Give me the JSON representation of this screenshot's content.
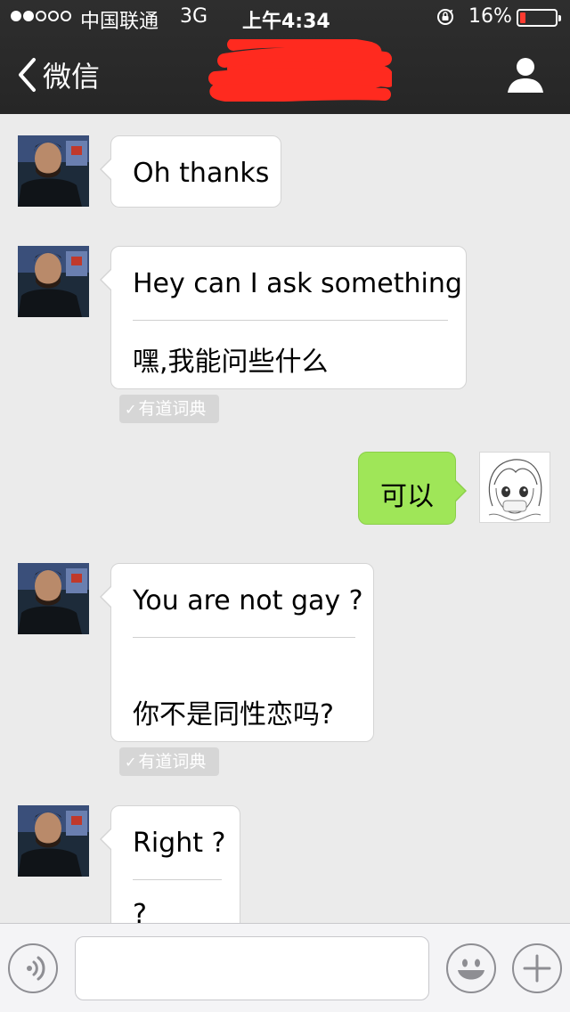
{
  "status_bar": {
    "signal_filled": 2,
    "signal_total": 5,
    "carrier": "中国联通",
    "network": "3G",
    "time": "上午4:34",
    "battery_percent_label": "16%",
    "battery_level": 0.16,
    "battery_color": "#ff3b30"
  },
  "nav": {
    "back_label": "微信",
    "back_icon": "chevron-left-icon",
    "title_redacted": true,
    "profile_icon": "person-icon"
  },
  "messages": [
    {
      "direction": "incoming",
      "sender": "contact",
      "text": "Oh thanks"
    },
    {
      "direction": "incoming",
      "sender": "contact",
      "text": "Hey can I ask something",
      "translation": "嘿,我能问些什么",
      "translation_source": "有道词典"
    },
    {
      "direction": "outgoing",
      "sender": "me",
      "text": "可以"
    },
    {
      "direction": "incoming",
      "sender": "contact",
      "text": "You are not gay ?",
      "translation": "你不是同性恋吗?",
      "translation_source": "有道词典"
    },
    {
      "direction": "incoming",
      "sender": "contact",
      "text": "Right ?",
      "translation": "?"
    }
  ],
  "toolbar": {
    "voice_icon": "voice-icon",
    "input_value": "",
    "emoji_icon": "smiley-icon",
    "plus_icon": "plus-icon"
  },
  "colors": {
    "outgoing_bubble": "#9fe658",
    "incoming_bubble": "#ffffff",
    "chat_background": "#ebebeb",
    "header_background": "#262626",
    "redaction": "#ff2a1f"
  }
}
